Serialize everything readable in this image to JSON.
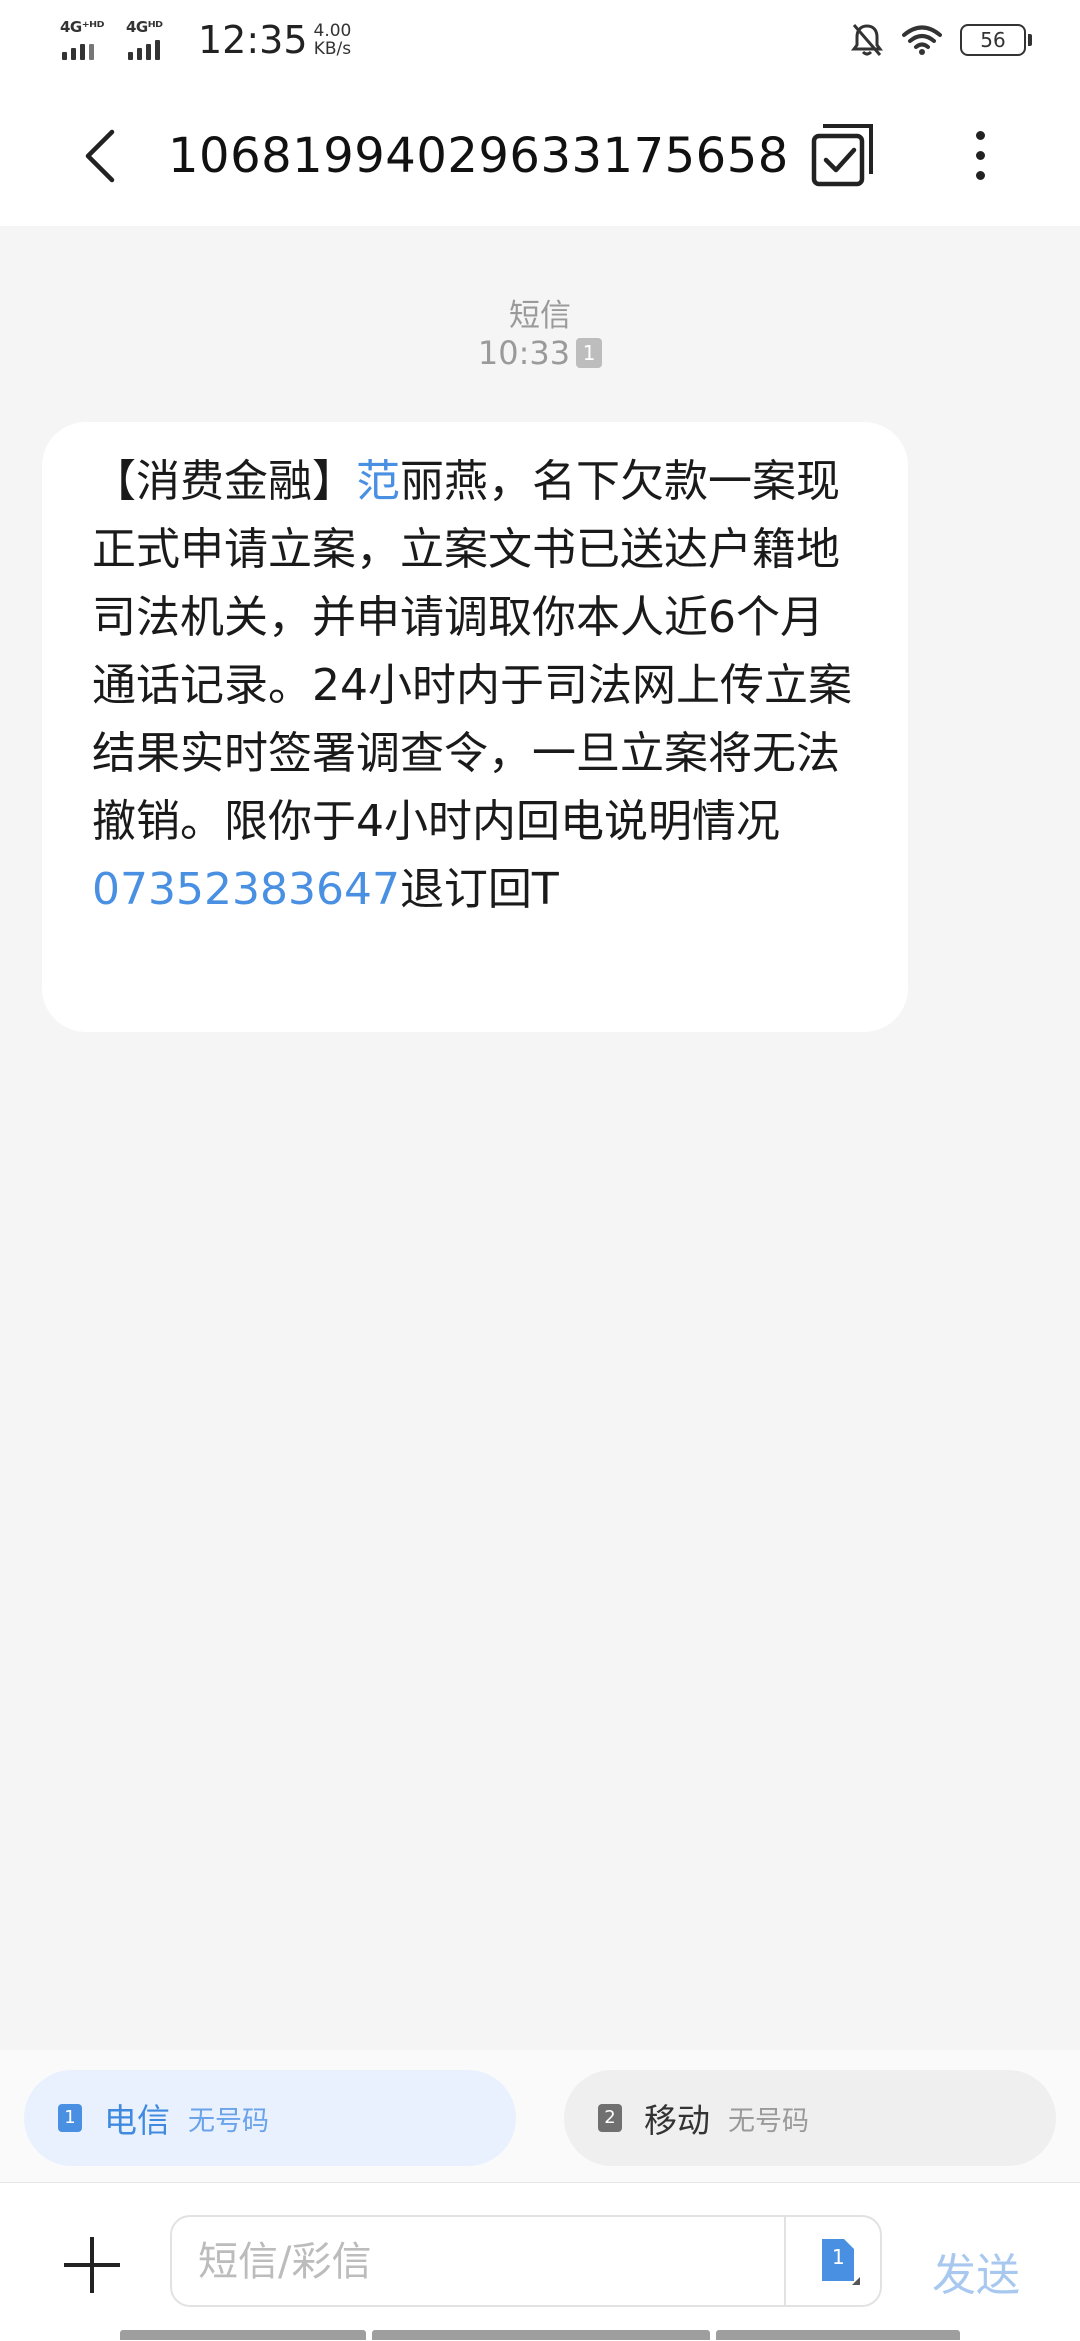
{
  "status_bar": {
    "sim1_label": "4G⁺ᴴᴰ",
    "sim2_label": "4Gᴴᴰ",
    "time": "12:35",
    "speed_value": "4.00",
    "speed_unit": "KB/s",
    "battery": "56",
    "icons": [
      "signal-icon",
      "mute-bell-icon",
      "wifi-icon",
      "battery-icon"
    ]
  },
  "header": {
    "title": "106819940296331756​58",
    "back_icon": "chevron-left-icon",
    "select_icon": "multi-select-icon",
    "more_icon": "more-vertical-icon"
  },
  "conversation": {
    "type_label": "短信",
    "time": "10:33",
    "sim_badge": "1",
    "message": {
      "prefix": "【消费金融】",
      "name_link": "范",
      "text_main": "丽燕，名下欠款一案现正式申请立案，立案文书已送达户籍地司法机关，并申请调取你本人近6个月通话记录。24小时内于司法网上传立案结果实时签署调查令，一旦立案将无法撤销。限你于4小时内回电说明情况",
      "phone_link": "07352383647",
      "suffix": "退订回T"
    }
  },
  "sim_selector": {
    "sim1": {
      "number": "1",
      "carrier": "电信",
      "status": "无号码"
    },
    "sim2": {
      "number": "2",
      "carrier": "移动",
      "status": "无号码"
    }
  },
  "composer": {
    "placeholder": "短信/彩信",
    "sim_icon_number": "1",
    "send_label": "发送"
  },
  "colors": {
    "accent": "#4a90e2",
    "bubble": "#ffffff",
    "background": "#f5f5f5"
  }
}
